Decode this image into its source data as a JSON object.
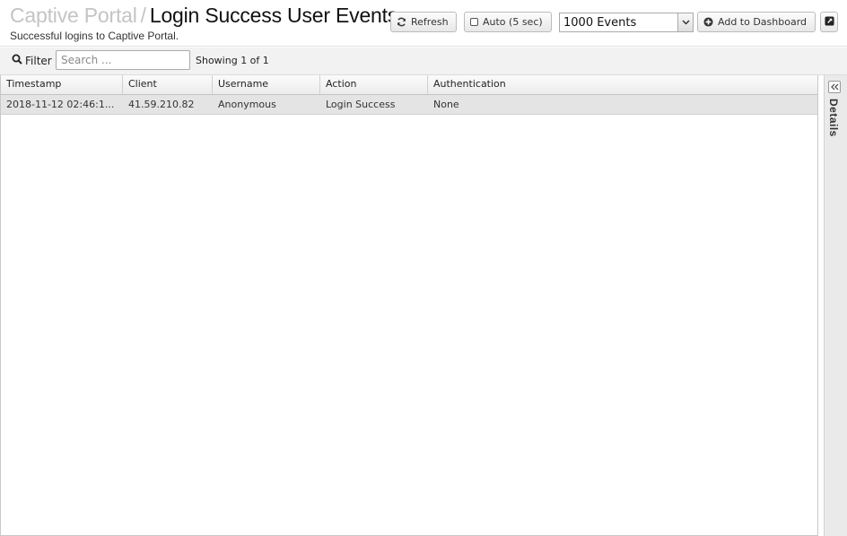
{
  "header": {
    "breadcrumb": "Captive Portal",
    "separator": "/",
    "title": "Login Success User Events",
    "subtitle": "Successful logins to Captive Portal."
  },
  "toolbar": {
    "refresh_label": "Refresh",
    "auto_label": "Auto (5 sec)",
    "auto_checked": false,
    "events_select": "1000 Events",
    "add_dashboard_label": "Add to Dashboard",
    "refresh_icon": "refresh-icon",
    "add_icon": "plus-circle-icon",
    "more_icon": "external-link-icon"
  },
  "filter": {
    "label": "Filter",
    "placeholder": "Search ...",
    "value": "",
    "showing": "Showing 1 of 1"
  },
  "table": {
    "columns": [
      "Timestamp",
      "Client",
      "Username",
      "Action",
      "Authentication"
    ],
    "rows": [
      [
        "2018-11-12 02:46:1...",
        "41.59.210.82",
        "Anonymous",
        "Login Success",
        "None"
      ]
    ]
  },
  "details_panel": {
    "label": "Details"
  }
}
